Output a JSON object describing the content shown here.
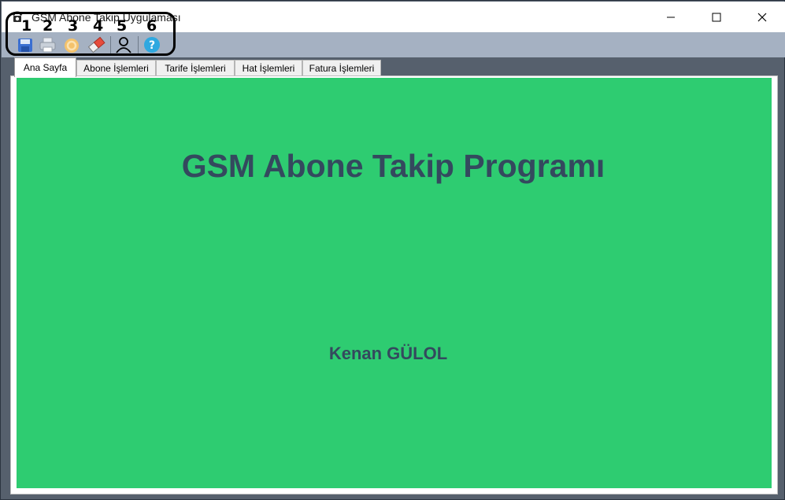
{
  "window": {
    "title": "GSM Abone Takip Uygulaması",
    "minimize_icon": "minimize-icon",
    "maximize_icon": "maximize-icon",
    "close_icon": "close-icon"
  },
  "toolbar": {
    "buttons": [
      {
        "number": "1",
        "icon": "save-icon"
      },
      {
        "number": "2",
        "icon": "print-icon"
      },
      {
        "number": "3",
        "icon": "refresh-icon"
      },
      {
        "number": "4",
        "icon": "eraser-icon"
      },
      {
        "number": "5",
        "icon": "user-icon"
      },
      {
        "number": "6",
        "icon": "help-icon"
      }
    ]
  },
  "tabs": [
    {
      "label": "Ana Sayfa",
      "active": true
    },
    {
      "label": "Abone İşlemleri",
      "active": false
    },
    {
      "label": "Tarife İşlemleri",
      "active": false
    },
    {
      "label": "Hat İşlemleri",
      "active": false
    },
    {
      "label": "Fatura İşlemleri",
      "active": false
    }
  ],
  "home": {
    "title": "GSM Abone Takip Programı",
    "author": "Kenan GÜLOL"
  },
  "colors": {
    "panel": "#2ecc71",
    "text": "#34495e",
    "toolbar": "#a5b1c2",
    "frame": "#56606d"
  }
}
